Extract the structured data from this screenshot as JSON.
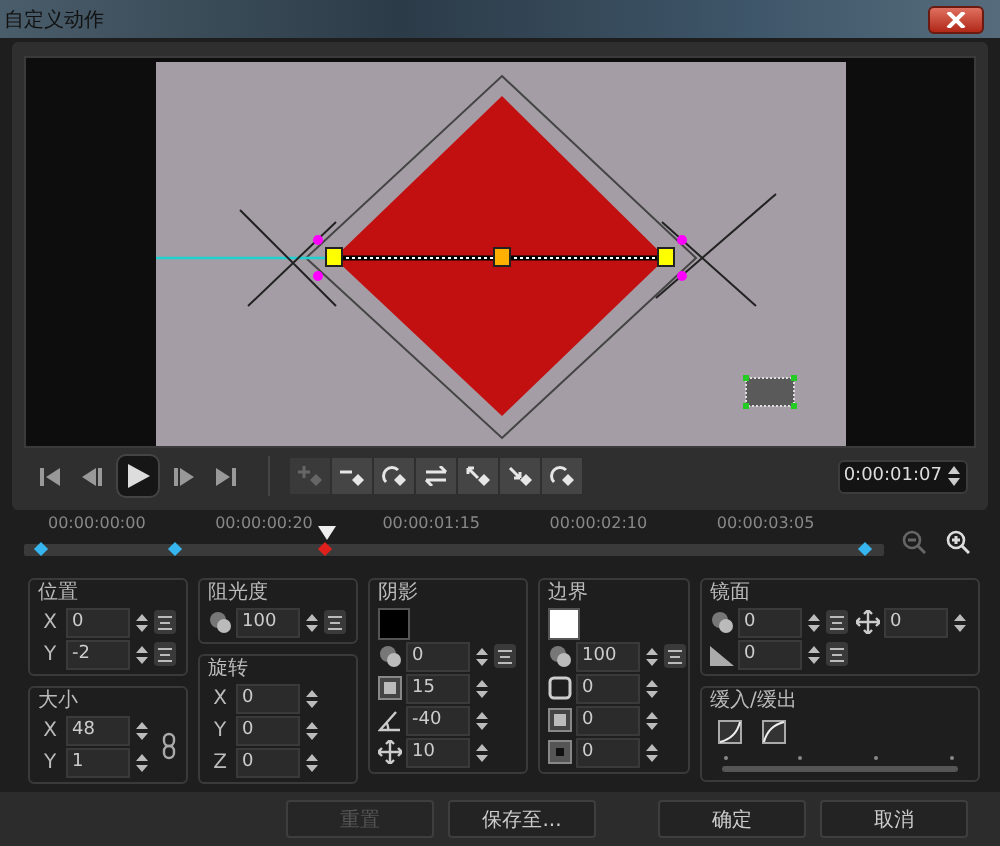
{
  "window": {
    "title": "自定义动作"
  },
  "transport": {
    "buttons": [
      {
        "kind": "start"
      },
      {
        "kind": "prev"
      },
      {
        "kind": "play"
      },
      {
        "kind": "next"
      },
      {
        "kind": "end"
      }
    ],
    "tools": [
      {
        "kind": "add",
        "disabled": true
      },
      {
        "kind": "remove",
        "disabled": false
      },
      {
        "kind": "reverse",
        "disabled": false
      },
      {
        "kind": "swap",
        "disabled": false
      },
      {
        "kind": "prev",
        "disabled": false
      },
      {
        "kind": "next",
        "disabled": false
      },
      {
        "kind": "rotate",
        "disabled": false
      }
    ],
    "timecode": "0:00:01:07"
  },
  "timeline": {
    "labels": [
      "00:00:00:00",
      "00:00:00:20",
      "00:00:01:15",
      "00:00:02:10",
      "00:00:03:05"
    ],
    "playhead": {
      "level": 0.35
    },
    "keyframes": [
      {
        "level": 0.02,
        "selected": false
      },
      {
        "level": 0.175,
        "selected": false
      },
      {
        "level": 0.35,
        "selected": true
      },
      {
        "level": 0.977,
        "selected": false
      }
    ]
  },
  "columns": [
    [
      {
        "kind": "fields",
        "title": "位置",
        "rows": [
          {
            "label": "X",
            "value": "0",
            "menu": true
          },
          {
            "label": "Y",
            "value": "-2",
            "menu": true
          }
        ]
      },
      {
        "kind": "fields",
        "title": "大小",
        "linked": true,
        "rows": [
          {
            "label": "X",
            "value": "48",
            "menu": false
          },
          {
            "label": "Y",
            "value": "1",
            "menu": false
          }
        ]
      }
    ],
    [
      {
        "kind": "fields",
        "title": "阻光度",
        "rows": [
          {
            "kind": "overlap",
            "value": "100",
            "menu": true
          }
        ]
      },
      {
        "kind": "fields",
        "title": "旋转",
        "rows": [
          {
            "label": "X",
            "value": "0",
            "menu": false
          },
          {
            "label": "Y",
            "value": "0",
            "menu": false
          },
          {
            "label": "Z",
            "value": "0",
            "menu": false
          }
        ]
      }
    ],
    [
      {
        "kind": "fields",
        "title": "阴影",
        "swatch": {
          "color": "#000000"
        },
        "rows": [
          {
            "kind": "overlap",
            "value": "0",
            "menu": true
          },
          {
            "kind": "square",
            "value": "15",
            "menu": false
          },
          {
            "kind": "angle",
            "value": "-40",
            "menu": false
          },
          {
            "kind": "move",
            "value": "10",
            "menu": false
          }
        ]
      }
    ],
    [
      {
        "kind": "fields",
        "title": "边界",
        "swatch": {
          "color": "#ffffff"
        },
        "rows": [
          {
            "kind": "overlap",
            "value": "100",
            "menu": true
          },
          {
            "kind": "outline",
            "value": "0",
            "menu": false
          },
          {
            "kind": "square",
            "value": "0",
            "menu": false
          },
          {
            "kind": "dotted",
            "value": "0",
            "menu": false
          }
        ]
      }
    ],
    [
      {
        "kind": "fields",
        "title": "镜面",
        "rows": [
          {
            "kind": "overlap",
            "value": "0",
            "menu": true
          },
          {
            "kind": "gradient",
            "value": "0",
            "menu": true
          }
        ],
        "side": [
          {
            "kind": "move",
            "value": "0",
            "menu": false
          }
        ]
      },
      {
        "kind": "easing",
        "title": "缓入/缓出",
        "curves": [
          {
            "kind": "in"
          },
          {
            "kind": "out"
          }
        ]
      }
    ]
  ],
  "footer": [
    {
      "label": "重置",
      "disabled": true
    },
    {
      "label": "保存至...",
      "disabled": false
    },
    {
      "label": "确定",
      "disabled": false
    },
    {
      "label": "取消",
      "disabled": false
    }
  ]
}
